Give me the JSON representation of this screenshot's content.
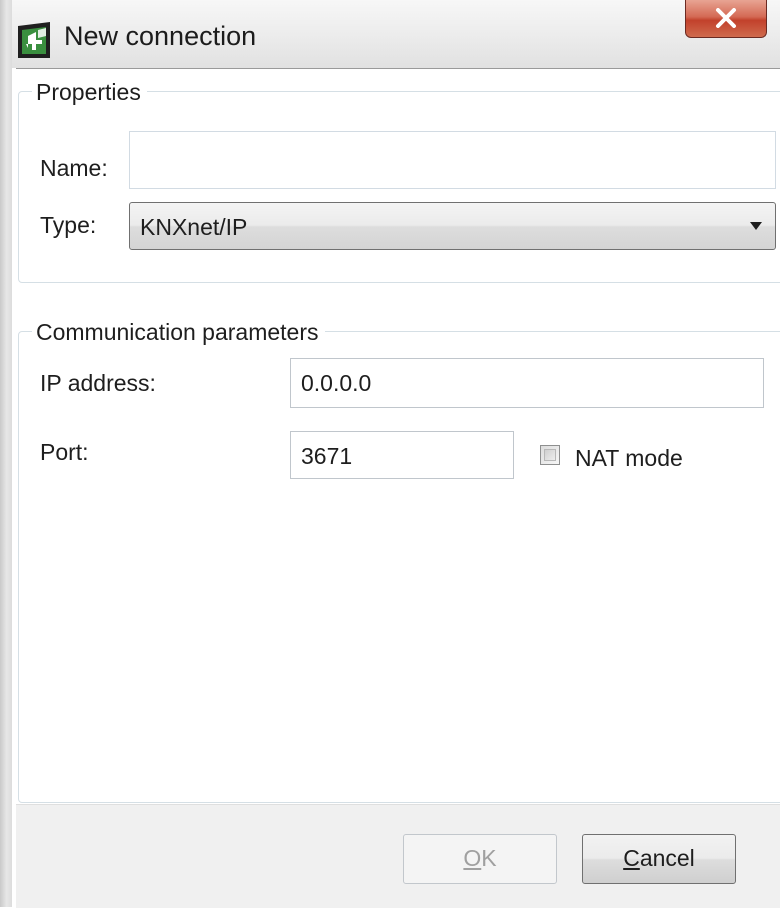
{
  "window": {
    "title": "New connection",
    "app_icon": "app-logo-icon",
    "close_icon": "close-icon"
  },
  "properties": {
    "legend": "Properties",
    "name_label": "Name:",
    "name_value": "",
    "type_label": "Type:",
    "type_value": "KNXnet/IP"
  },
  "communication": {
    "legend": "Communication parameters",
    "ip_label": "IP address:",
    "ip_value": "0.0.0.0",
    "port_label": "Port:",
    "port_value": "3671",
    "nat_label": "NAT mode",
    "nat_checked": false
  },
  "buttons": {
    "ok_mnemonic": "O",
    "ok_rest": "K",
    "ok_enabled": false,
    "cancel_mnemonic": "C",
    "cancel_rest": "ancel"
  },
  "colors": {
    "close_button": "#c2412b",
    "app_icon_green": "#2e7d32"
  }
}
